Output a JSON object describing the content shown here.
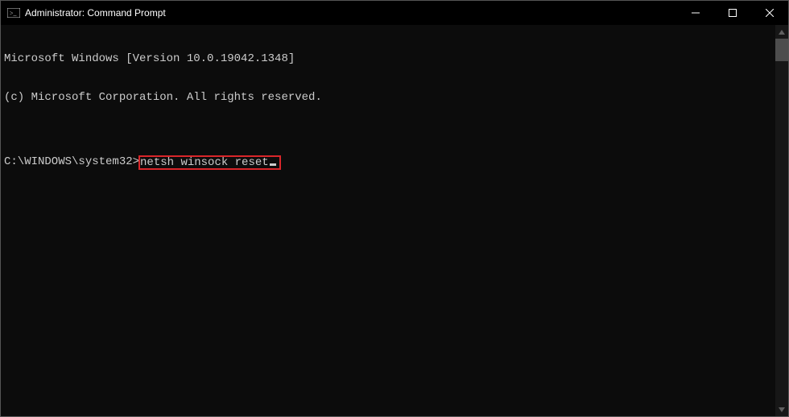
{
  "titlebar": {
    "title": "Administrator: Command Prompt"
  },
  "console": {
    "line1": "Microsoft Windows [Version 10.0.19042.1348]",
    "line2": "(c) Microsoft Corporation. All rights reserved.",
    "blank": "",
    "prompt": "C:\\WINDOWS\\system32>",
    "command": "netsh winsock reset"
  }
}
